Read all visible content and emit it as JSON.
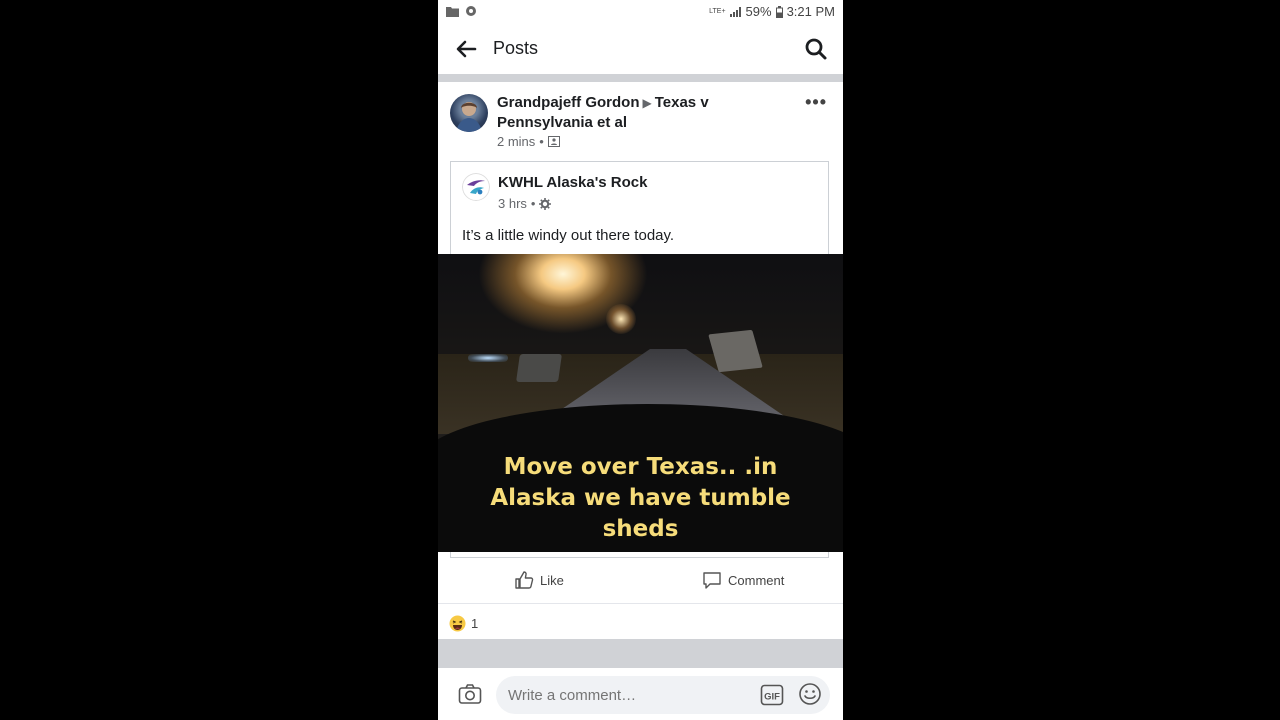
{
  "status_bar": {
    "network": "LTE+",
    "battery": "59%",
    "time": "3:21 PM"
  },
  "header": {
    "title": "Posts"
  },
  "post": {
    "author": "Grandpajeff Gordon",
    "target": "Texas v Pennsylvania et al",
    "time": "2 mins",
    "shared": {
      "page_name": "KWHL Alaska's Rock",
      "time": "3 hrs",
      "text": "It’s a little windy out there today.",
      "caption_lines": [
        "Move over Texas.. .in",
        "Alaska we have tumble",
        "sheds"
      ]
    },
    "actions": {
      "like": "Like",
      "comment": "Comment"
    },
    "reaction_count": "1"
  },
  "composer": {
    "placeholder": "Write a comment…",
    "gif": "GIF"
  },
  "colors": {
    "caption": "#f6dc7a",
    "text": "#1c1e21",
    "muted": "#65676b",
    "separator": "#d0d2d6"
  }
}
